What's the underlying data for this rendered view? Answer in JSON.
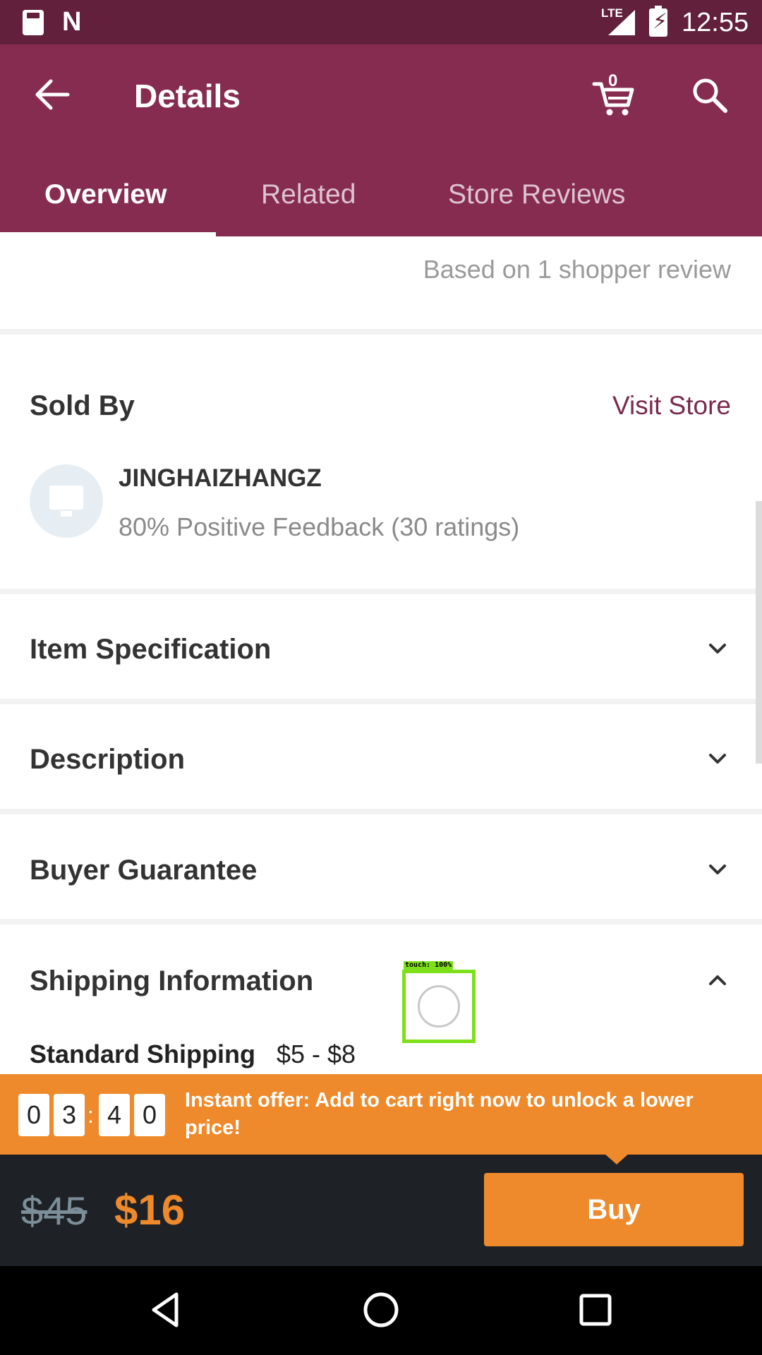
{
  "status_bar": {
    "network": "LTE",
    "time": "12:55",
    "icons": [
      "sd-card-icon",
      "n-notification-icon",
      "signal-icon",
      "battery-charging-icon"
    ]
  },
  "header": {
    "title": "Details",
    "cart_count": "0",
    "icons": [
      "back-arrow-icon",
      "cart-icon",
      "search-icon"
    ]
  },
  "tabs": [
    {
      "label": "Overview",
      "active": true
    },
    {
      "label": "Related",
      "active": false
    },
    {
      "label": "Store Reviews",
      "active": false
    }
  ],
  "reviews": {
    "summary": "Based on 1 shopper review"
  },
  "seller": {
    "heading": "Sold By",
    "visit_store": "Visit Store",
    "name": "JINGHAIZHANGZ",
    "feedback": "80% Positive Feedback (30 ratings)"
  },
  "sections": [
    {
      "label": "Item Specification",
      "expanded": false
    },
    {
      "label": "Description",
      "expanded": false
    },
    {
      "label": "Buyer Guarantee",
      "expanded": false
    },
    {
      "label": "Shipping Information",
      "expanded": true
    }
  ],
  "shipping": {
    "method": "Standard Shipping",
    "price": "$5 - $8"
  },
  "touch_indicator": {
    "label": "touch: 100%"
  },
  "offer": {
    "timer_digits": [
      "0",
      "3",
      "4",
      "0"
    ],
    "separator": ":",
    "text": "Instant offer: Add to cart right now to unlock a lower price!",
    "color": "#ee8a2b"
  },
  "purchase": {
    "original_price": "$45",
    "price": "$16",
    "buy_label": "Buy"
  },
  "colors": {
    "status_bar": "#62203c",
    "app_bar": "#872c51",
    "accent_link": "#7a2a4c",
    "buy_bar": "#1e2226"
  }
}
